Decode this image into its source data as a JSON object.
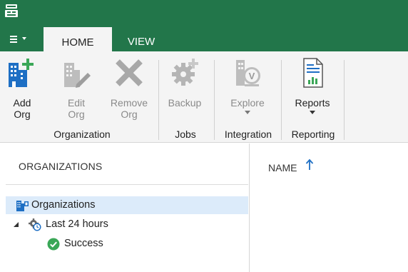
{
  "app": {
    "icon": "veeam-app-icon"
  },
  "tabs": {
    "menu_icon": "hamburger-menu-icon",
    "home_label": "HOME",
    "view_label": "VIEW"
  },
  "ribbon": {
    "organization_group": {
      "label": "Organization",
      "add_org_line1": "Add",
      "add_org_line2": "Org",
      "edit_org_line1": "Edit",
      "edit_org_line2": "Org",
      "remove_org_line1": "Remove",
      "remove_org_line2": "Org"
    },
    "jobs_group": {
      "label": "Jobs",
      "backup_label": "Backup"
    },
    "integration_group": {
      "label": "Integration",
      "explore_label": "Explore"
    },
    "reporting_group": {
      "label": "Reporting",
      "reports_label": "Reports"
    }
  },
  "left_pane": {
    "header": "ORGANIZATIONS",
    "tree": {
      "organizations": "Organizations",
      "last24": "Last 24 hours",
      "success": "Success"
    }
  },
  "right_pane": {
    "column_name": "NAME"
  },
  "colors": {
    "brand_green": "#22764a",
    "accent_blue": "#1e6fc4",
    "success_green": "#3aa757",
    "selection": "#dcebfa"
  }
}
